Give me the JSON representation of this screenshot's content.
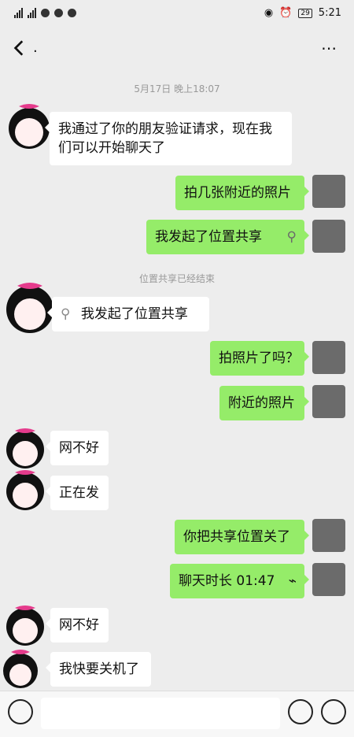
{
  "statusbar": {
    "time": "5:21",
    "battery": "29"
  },
  "header": {
    "title": "."
  },
  "timestamps": [
    "5月17日 晚上18:07"
  ],
  "system": [
    "位置共享已经结束"
  ],
  "messages": [
    {
      "side": "in",
      "text": "我通过了你的朋友验证请求，现在我\n们可以开始聊天了"
    },
    {
      "side": "out",
      "text": "拍几张附近的照片"
    },
    {
      "side": "out",
      "text": "我发起了位置共享"
    },
    {
      "side": "in",
      "text": "我发起了位置共享"
    },
    {
      "side": "out",
      "text": "拍照片了吗？"
    },
    {
      "side": "out",
      "text": "附近的照片"
    },
    {
      "side": "in",
      "text": "网不好"
    },
    {
      "side": "in",
      "text": "正在发"
    },
    {
      "side": "out",
      "text": "你把共享位置关了"
    },
    {
      "side": "out",
      "text": "聊天时长 01:47"
    },
    {
      "side": "in",
      "text": "网不好"
    },
    {
      "side": "in",
      "text": "我快要关机了"
    }
  ]
}
